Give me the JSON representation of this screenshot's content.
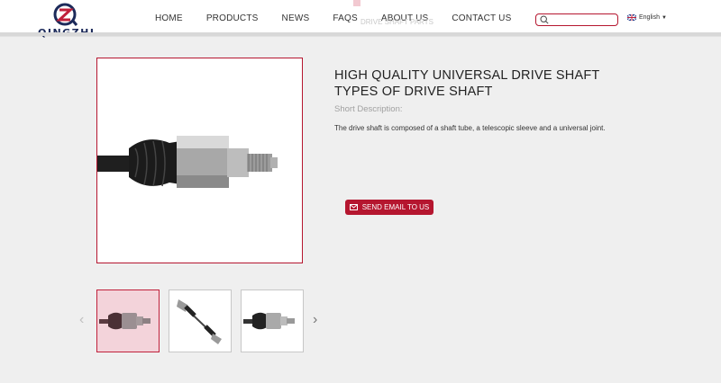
{
  "header": {
    "logo_text": "QINGZHI",
    "nav": [
      {
        "label": "HOME"
      },
      {
        "label": "PRODUCTS"
      },
      {
        "label": "NEWS"
      },
      {
        "label": "FAQS"
      },
      {
        "label": "ABOUT US"
      },
      {
        "label": "CONTACT US"
      }
    ],
    "search": {
      "placeholder": "",
      "icon": "search-icon"
    },
    "language": "English",
    "ghost_text": "DRIVE SHAFT PARTS"
  },
  "product": {
    "title": "HIGH QUALITY UNIVERSAL DRIVE SHAFT TYPES OF DRIVE SHAFT",
    "short_label": "Short Description:",
    "description": "The drive shaft is composed of a shaft tube, a telescopic sleeve and a universal joint.",
    "send_button": "SEND EMAIL TO US"
  },
  "gallery": {
    "thumbnails": [
      "drive-shaft-thumb-1",
      "drive-shaft-thumb-2",
      "drive-shaft-thumb-3"
    ],
    "active_index": 0,
    "prev_icon": "chevron-left-icon",
    "next_icon": "chevron-right-icon"
  },
  "colors": {
    "accent": "#b5162f",
    "background": "#efefef",
    "thumb_active": "#f3d3da"
  }
}
